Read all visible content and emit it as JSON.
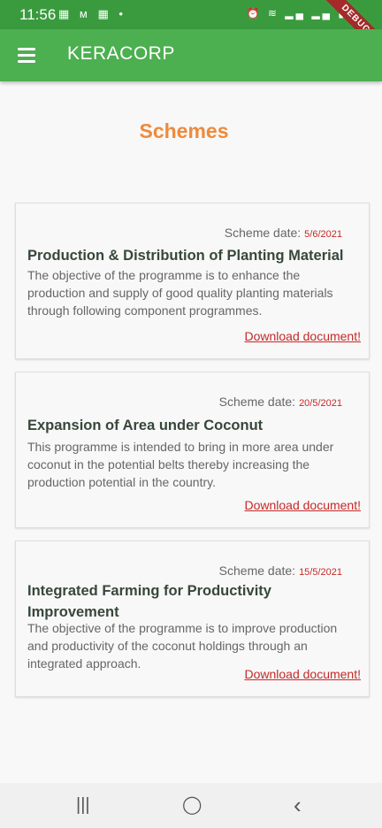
{
  "status_bar": {
    "time": "11:56",
    "left_icons": "▦ ᴍ ▦ •",
    "right_icons": "⏰ ≋ ▂▄ ▂▄ ▮"
  },
  "debug_banner": "DEBUG",
  "app_bar": {
    "title": "KERACORP",
    "menu_icon": "hamburger-menu-icon"
  },
  "page": {
    "title": "Schemes"
  },
  "schemes": [
    {
      "date_label": "Scheme date:",
      "date": "5/6/2021",
      "title": "Production & Distribution of Planting Material",
      "description": "The objective of the programme is to enhance the production and supply of good quality planting materials through following component programmes.",
      "link": "Download document!"
    },
    {
      "date_label": "Scheme date:",
      "date": "20/5/2021",
      "title": "Expansion of Area under Coconut",
      "description": "This programme is intended to bring in more area under coconut in the potential belts thereby increasing the production potential in the country.",
      "link": "Download document!"
    },
    {
      "date_label": "Scheme date:",
      "date": "15/5/2021",
      "title": "Integrated Farming for Productivity Improvement",
      "description": "The objective of the programme is to improve production and productivity of the coconut holdings through an integrated approach.",
      "link": "Download document!"
    }
  ],
  "nav_bar": {
    "recents_icon": "|||",
    "home_icon": "◯",
    "back_icon": "‹"
  },
  "colors": {
    "app_bar": "#4caf50",
    "status_bar": "#3a9b3e",
    "title_accent": "#ef8a3a",
    "link": "#c62828"
  }
}
